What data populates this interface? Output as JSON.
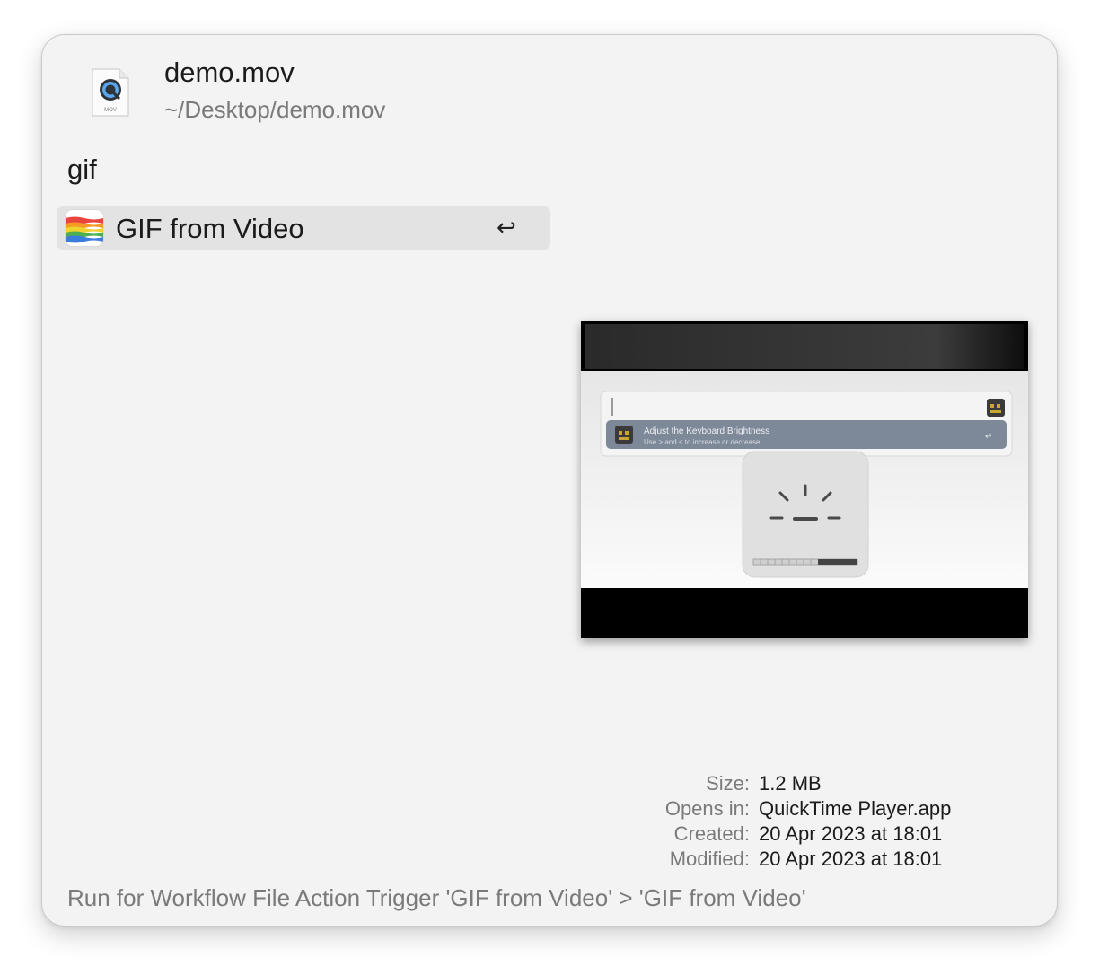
{
  "file": {
    "name": "demo.mov",
    "path": "~/Desktop/demo.mov",
    "type_badge": "MOV",
    "icon": "quicktime-movie-file-icon"
  },
  "search": {
    "query": "gif"
  },
  "results": [
    {
      "label": "GIF from Video",
      "shortcut_glyph": "↩",
      "icon": "rainbow-gif-icon",
      "selected": true
    }
  ],
  "preview": {
    "inner_title": "Adjust the Keyboard Brightness",
    "inner_subtitle": "Use > and < to increase or decrease"
  },
  "metadata": [
    {
      "key": "Size:",
      "value": "1.2 MB"
    },
    {
      "key": "Opens in:",
      "value": "QuickTime Player.app"
    },
    {
      "key": "Created:",
      "value": "20 Apr 2023 at 18:01"
    },
    {
      "key": "Modified:",
      "value": "20 Apr 2023 at 18:01"
    }
  ],
  "footer": {
    "text": "Run for Workflow File Action Trigger 'GIF from Video' > 'GIF from Video'"
  }
}
